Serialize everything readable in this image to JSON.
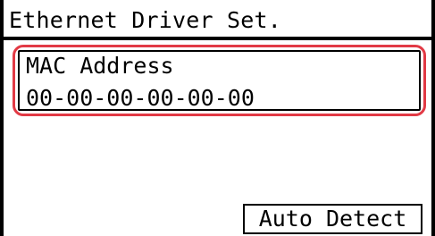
{
  "header": {
    "title": "Ethernet Driver Set."
  },
  "selected_item": {
    "label": "MAC Address",
    "value": "00-00-00-00-00-00"
  },
  "actions": {
    "auto_detect_label": "Auto Detect"
  },
  "colors": {
    "highlight": "#e23a45",
    "foreground": "#000000",
    "background": "#ffffff"
  }
}
